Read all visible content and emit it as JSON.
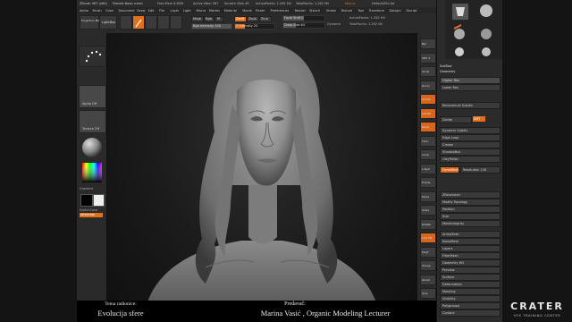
{
  "titlebar": {
    "app": "ZBrush 4R7 (x64)",
    "doc": "Female Basic mesh",
    "mem": "Free Mem 8.8GB",
    "active": "Active Mem 567",
    "scratch": "Scratch Disk 49",
    "points": "ActivePoints: 1.262 Mil",
    "total": "TotalPoints: 1.262 Mil",
    "menus": "Menus",
    "script": "DefaultZScript"
  },
  "menu": [
    "Alpha",
    "Brush",
    "Color",
    "Document",
    "Draw",
    "Edit",
    "File",
    "Layer",
    "Light",
    "Macro",
    "Marker",
    "Material",
    "Movie",
    "Picker",
    "Preferences",
    "Render",
    "Stencil",
    "Stroke",
    "Texture",
    "Tool",
    "Transform",
    "Zplugin",
    "Zscript"
  ],
  "toptray": {
    "projection": "Projection Master",
    "lightbox": "LightBox",
    "mrgb": "Mrgb",
    "rgb": "Rgb",
    "m": "M",
    "zadd": "Zadd",
    "zsub": "Zsub",
    "zcut": "Zcut",
    "focal": "Focal Shift 0",
    "draw_size": "Draw Size 64",
    "dynamic": "Dynamic",
    "rgb_intensity": "Rgb Intensity 100",
    "z_intensity": "Z Intensity 25",
    "active_points": "ActivePoints: 1.262 Mil",
    "total_points": "TotalPoints: 1.262 Mil"
  },
  "lefttray": {
    "texture_off": "Texture Off",
    "alpha_off": "Alpha Off",
    "gradient": "Gradient",
    "switch_color": "SwitchColor",
    "alternate": "Alternate"
  },
  "shelf": [
    "Bpr",
    "SPix 3",
    "Scroll",
    "Zoom",
    "Actual",
    "AAHalf",
    "Persp",
    "Floor",
    "Local",
    "L.Sym",
    "Frame",
    "Move",
    "Scale",
    "Rotate",
    "Line Fill",
    "PolyF",
    "Transp",
    "Ghost",
    "Solo",
    "Xpose"
  ],
  "rightpanel": {
    "subtool": "SubTool",
    "geometry": "Geometry",
    "items": [
      "Higher Res",
      "Lower Res",
      "Reconstruct Subdiv",
      "Divide",
      "Dynamic Subdiv",
      "Edge Loop",
      "Crease",
      "ShadowBox",
      "ClayPolish",
      "DynaMesh",
      "ZRemesher",
      "Modify Topology",
      "Position",
      "Size",
      "MeshIntegrity",
      "ArrayMesh",
      "NanoMesh",
      "Layers",
      "FiberMesh",
      "Geometry HD",
      "Preview",
      "Surface",
      "Deformation",
      "Masking",
      "Visibility",
      "Polygroups",
      "Contact"
    ],
    "dynamesh_resolution": "Resolution 128",
    "smt": "SMT",
    "smt_val": "Sub 2"
  },
  "caption": {
    "topic_label": "Tema radionice:",
    "topic": "Evolucija sfere",
    "presenter_label": "Predavač:",
    "presenter": "Marina Vasić , Organic Modeling Lecturer"
  },
  "logo": {
    "name": "CRATER",
    "sub": "VFX TRAINING CENTER"
  },
  "colors": {
    "accent": "#e2701a",
    "ui_bg": "#2a2a2a",
    "viewport_bg": "#1a1a1a",
    "clay": "#8e8e8e"
  }
}
